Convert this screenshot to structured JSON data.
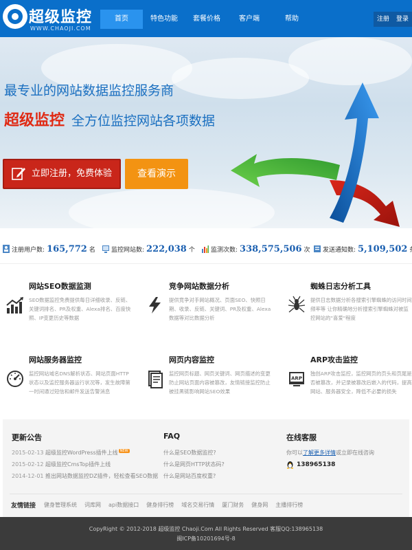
{
  "header": {
    "logo_name": "超级监控",
    "logo_domain": "WWW.CHAOJI.COM",
    "nav": [
      "首页",
      "特色功能",
      "套餐价格",
      "客户端",
      "帮助"
    ],
    "register": "注册",
    "login": "登录"
  },
  "banner": {
    "tagline1": "最专业的网站数据监控服务商",
    "brand": "超级监控",
    "tagline2": "全方位监控网站各项数据",
    "register_button": "立即注册，免费体验",
    "demo_button": "查看演示"
  },
  "stats": [
    {
      "label": "注册用户数:",
      "value": "165,772",
      "unit": "名",
      "icon": "user-icon"
    },
    {
      "label": "监控网站数:",
      "value": "222,038",
      "unit": "个",
      "icon": "monitor-icon"
    },
    {
      "label": "监测次数:",
      "value": "338,575,506",
      "unit": "次",
      "icon": "chart-icon"
    },
    {
      "label": "发送通知数:",
      "value": "5,109,502",
      "unit": "条",
      "icon": "notify-icon"
    }
  ],
  "features": [
    {
      "title": "网站SEO数据监测",
      "desc": "SEO数据监控免费提供每日详细收录、反链、关键词排名、PR及权重、Alexa排名、百度快照、IP变更历史等数据",
      "icon": "seo-chart-icon"
    },
    {
      "title": "竞争网站数据分析",
      "desc": "提供竞争对手网站概况、页面SEO、快照日期、收录、反链、关键词、PR及权重、Alexa数据等对比数据分析",
      "icon": "lightning-icon"
    },
    {
      "title": "蜘蛛日志分析工具",
      "desc": "提供日志数据分析各搜索引擎蜘蛛的访问时间频率等 让你精确地分析搜索引擎蜘蛛对被监控网站的\"喜爱\"程度",
      "icon": "spider-icon"
    },
    {
      "title": "网站服务器监控",
      "desc": "监控网站域名DNS解析状态、网站页面HTTP状态以及监控服务器运行状况等，发生故障第一时间通过短信和邮件发送告警消息",
      "icon": "gauge-icon"
    },
    {
      "title": "网页内容监控",
      "desc": "监控网页标题、网页关键词、网页描述的变更防止网站页面内容被篡改，友情链接监控防止被挂黑链影响网站SEO效果",
      "icon": "document-icon"
    },
    {
      "title": "ARP攻击监控",
      "desc": "独创ARP攻击监控，监控网页的页头和页尾是否被篡改，并记录被篡改后嵌入的代码，提高网站、服务器安全，降低不必要的损失",
      "icon": "arp-icon"
    }
  ],
  "news": {
    "title": "更新公告",
    "items": [
      {
        "date": "2015-02-13",
        "text": "超级监控WordPress插件上线",
        "badge": "NEW"
      },
      {
        "date": "2015-02-12",
        "text": "超级监控CmsTop插件上线"
      },
      {
        "date": "2014-12-01",
        "text": "推出网站数据监控DZ插件，轻松查看SEO数据"
      }
    ]
  },
  "faq": {
    "title": "FAQ",
    "items": [
      "什么是SEO数据监控?",
      "什么是网页HTTP状态码?",
      "什么是网站百度权重?"
    ]
  },
  "service": {
    "title": "在线客服",
    "prefix": "你可以",
    "link": "了解更多详情",
    "suffix": "或立即在线咨询",
    "qq": "138965138"
  },
  "links": {
    "title": "友情链接",
    "items": [
      "健身管理系统",
      "词库网",
      "api数据接口",
      "健身排行榜",
      "域名交易行情",
      "厦门财务",
      "健身网",
      "主播排行榜"
    ]
  },
  "footer": {
    "line1": "CopyRight © 2012-2018 超级监控 Chaoji.Com All Rights Reserved 客服QQ:138965138",
    "line2": "闽ICP备10201694号-8"
  },
  "colors": {
    "header_blue": "#0a6fca",
    "nav_active": "#2a93ee",
    "brand_red": "#e02a14",
    "register_red": "#c9261a",
    "demo_orange": "#f39312",
    "number_blue": "#1a5fb0"
  }
}
